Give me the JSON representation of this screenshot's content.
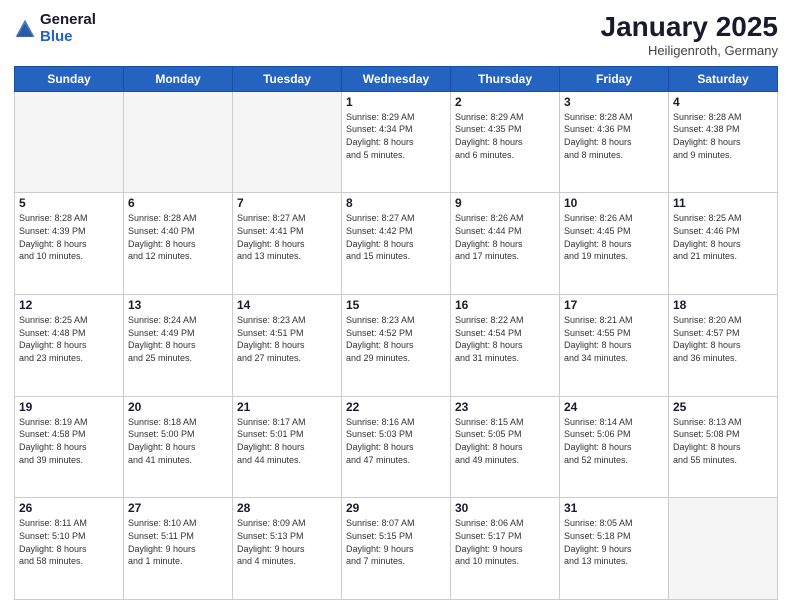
{
  "logo": {
    "general": "General",
    "blue": "Blue"
  },
  "title": "January 2025",
  "location": "Heiligenroth, Germany",
  "weekdays": [
    "Sunday",
    "Monday",
    "Tuesday",
    "Wednesday",
    "Thursday",
    "Friday",
    "Saturday"
  ],
  "weeks": [
    [
      {
        "day": "",
        "info": ""
      },
      {
        "day": "",
        "info": ""
      },
      {
        "day": "",
        "info": ""
      },
      {
        "day": "1",
        "info": "Sunrise: 8:29 AM\nSunset: 4:34 PM\nDaylight: 8 hours\nand 5 minutes."
      },
      {
        "day": "2",
        "info": "Sunrise: 8:29 AM\nSunset: 4:35 PM\nDaylight: 8 hours\nand 6 minutes."
      },
      {
        "day": "3",
        "info": "Sunrise: 8:28 AM\nSunset: 4:36 PM\nDaylight: 8 hours\nand 8 minutes."
      },
      {
        "day": "4",
        "info": "Sunrise: 8:28 AM\nSunset: 4:38 PM\nDaylight: 8 hours\nand 9 minutes."
      }
    ],
    [
      {
        "day": "5",
        "info": "Sunrise: 8:28 AM\nSunset: 4:39 PM\nDaylight: 8 hours\nand 10 minutes."
      },
      {
        "day": "6",
        "info": "Sunrise: 8:28 AM\nSunset: 4:40 PM\nDaylight: 8 hours\nand 12 minutes."
      },
      {
        "day": "7",
        "info": "Sunrise: 8:27 AM\nSunset: 4:41 PM\nDaylight: 8 hours\nand 13 minutes."
      },
      {
        "day": "8",
        "info": "Sunrise: 8:27 AM\nSunset: 4:42 PM\nDaylight: 8 hours\nand 15 minutes."
      },
      {
        "day": "9",
        "info": "Sunrise: 8:26 AM\nSunset: 4:44 PM\nDaylight: 8 hours\nand 17 minutes."
      },
      {
        "day": "10",
        "info": "Sunrise: 8:26 AM\nSunset: 4:45 PM\nDaylight: 8 hours\nand 19 minutes."
      },
      {
        "day": "11",
        "info": "Sunrise: 8:25 AM\nSunset: 4:46 PM\nDaylight: 8 hours\nand 21 minutes."
      }
    ],
    [
      {
        "day": "12",
        "info": "Sunrise: 8:25 AM\nSunset: 4:48 PM\nDaylight: 8 hours\nand 23 minutes."
      },
      {
        "day": "13",
        "info": "Sunrise: 8:24 AM\nSunset: 4:49 PM\nDaylight: 8 hours\nand 25 minutes."
      },
      {
        "day": "14",
        "info": "Sunrise: 8:23 AM\nSunset: 4:51 PM\nDaylight: 8 hours\nand 27 minutes."
      },
      {
        "day": "15",
        "info": "Sunrise: 8:23 AM\nSunset: 4:52 PM\nDaylight: 8 hours\nand 29 minutes."
      },
      {
        "day": "16",
        "info": "Sunrise: 8:22 AM\nSunset: 4:54 PM\nDaylight: 8 hours\nand 31 minutes."
      },
      {
        "day": "17",
        "info": "Sunrise: 8:21 AM\nSunset: 4:55 PM\nDaylight: 8 hours\nand 34 minutes."
      },
      {
        "day": "18",
        "info": "Sunrise: 8:20 AM\nSunset: 4:57 PM\nDaylight: 8 hours\nand 36 minutes."
      }
    ],
    [
      {
        "day": "19",
        "info": "Sunrise: 8:19 AM\nSunset: 4:58 PM\nDaylight: 8 hours\nand 39 minutes."
      },
      {
        "day": "20",
        "info": "Sunrise: 8:18 AM\nSunset: 5:00 PM\nDaylight: 8 hours\nand 41 minutes."
      },
      {
        "day": "21",
        "info": "Sunrise: 8:17 AM\nSunset: 5:01 PM\nDaylight: 8 hours\nand 44 minutes."
      },
      {
        "day": "22",
        "info": "Sunrise: 8:16 AM\nSunset: 5:03 PM\nDaylight: 8 hours\nand 47 minutes."
      },
      {
        "day": "23",
        "info": "Sunrise: 8:15 AM\nSunset: 5:05 PM\nDaylight: 8 hours\nand 49 minutes."
      },
      {
        "day": "24",
        "info": "Sunrise: 8:14 AM\nSunset: 5:06 PM\nDaylight: 8 hours\nand 52 minutes."
      },
      {
        "day": "25",
        "info": "Sunrise: 8:13 AM\nSunset: 5:08 PM\nDaylight: 8 hours\nand 55 minutes."
      }
    ],
    [
      {
        "day": "26",
        "info": "Sunrise: 8:11 AM\nSunset: 5:10 PM\nDaylight: 8 hours\nand 58 minutes."
      },
      {
        "day": "27",
        "info": "Sunrise: 8:10 AM\nSunset: 5:11 PM\nDaylight: 9 hours\nand 1 minute."
      },
      {
        "day": "28",
        "info": "Sunrise: 8:09 AM\nSunset: 5:13 PM\nDaylight: 9 hours\nand 4 minutes."
      },
      {
        "day": "29",
        "info": "Sunrise: 8:07 AM\nSunset: 5:15 PM\nDaylight: 9 hours\nand 7 minutes."
      },
      {
        "day": "30",
        "info": "Sunrise: 8:06 AM\nSunset: 5:17 PM\nDaylight: 9 hours\nand 10 minutes."
      },
      {
        "day": "31",
        "info": "Sunrise: 8:05 AM\nSunset: 5:18 PM\nDaylight: 9 hours\nand 13 minutes."
      },
      {
        "day": "",
        "info": ""
      }
    ]
  ]
}
